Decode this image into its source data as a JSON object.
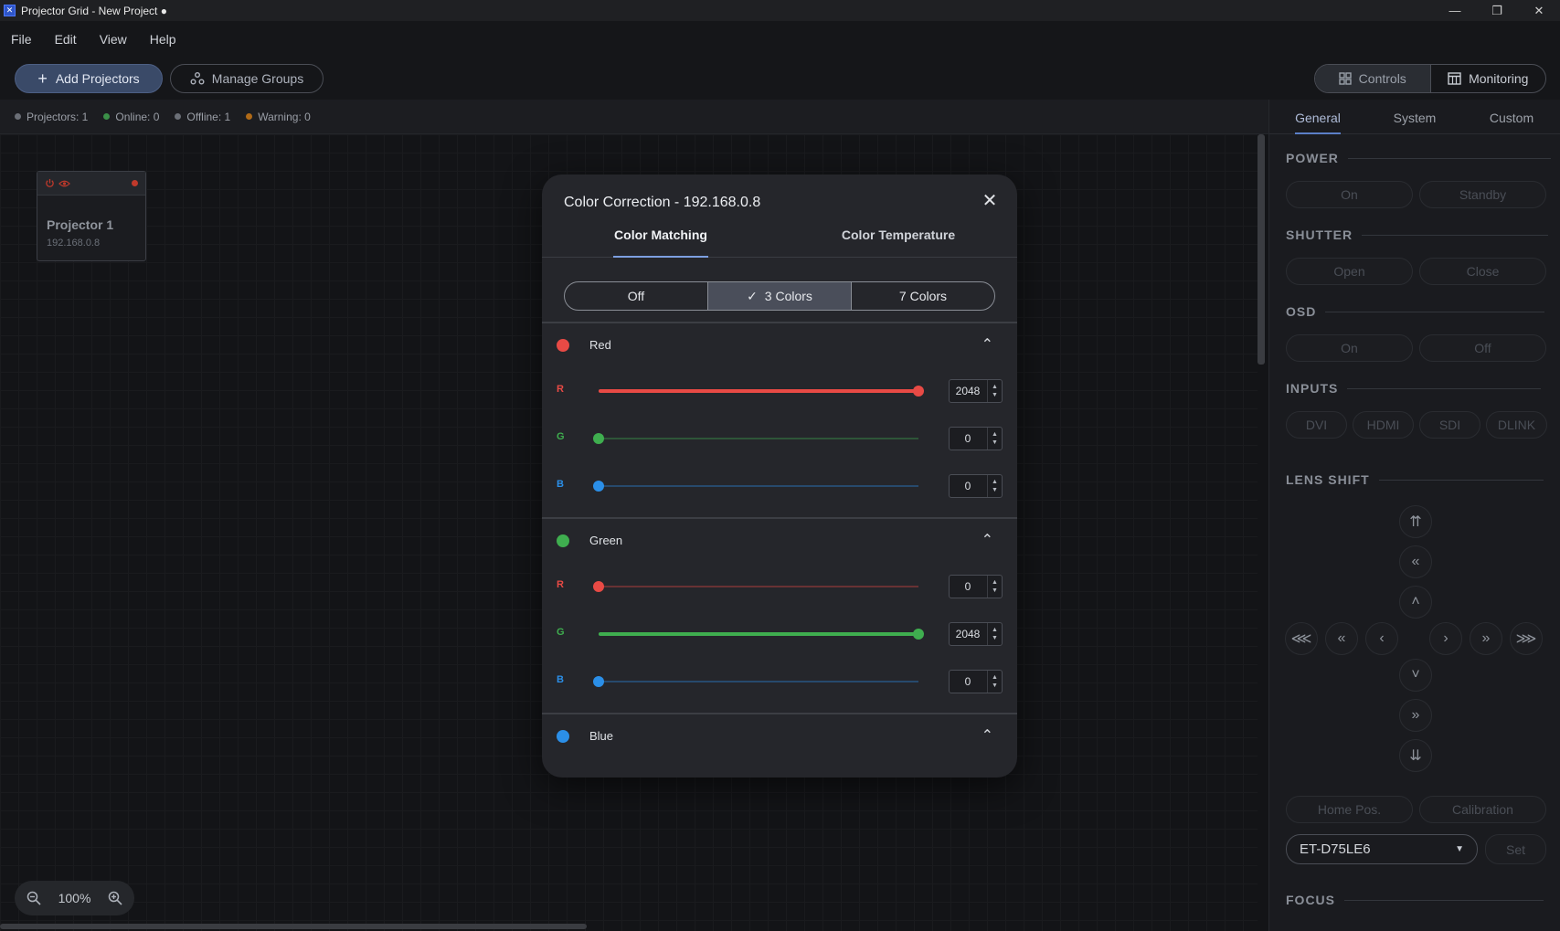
{
  "window": {
    "title": "Projector Grid - New Project ●",
    "icon": "app-icon"
  },
  "menu": [
    "File",
    "Edit",
    "View",
    "Help"
  ],
  "toolbar": {
    "add_projectors": "Add Projectors",
    "manage_groups": "Manage Groups",
    "controls": "Controls",
    "monitoring": "Monitoring"
  },
  "status": {
    "projectors": "Projectors: 1",
    "online": "Online: 0",
    "offline": "Offline: 1",
    "warning": "Warning: 0",
    "colors": {
      "projectors": "#6b6f77",
      "online": "#3b8f48",
      "offline": "#6b6f77",
      "warning": "#b06a17"
    }
  },
  "canvas": {
    "projector": {
      "name": "Projector 1",
      "ip": "192.168.0.8"
    },
    "zoom": "100%"
  },
  "panel": {
    "tabs": [
      "General",
      "System",
      "Custom"
    ],
    "active_tab": "General",
    "power": {
      "title": "POWER",
      "on": "On",
      "standby": "Standby"
    },
    "shutter": {
      "title": "SHUTTER",
      "open": "Open",
      "close": "Close"
    },
    "osd": {
      "title": "OSD",
      "on": "On",
      "off": "Off"
    },
    "inputs": {
      "title": "INPUTS",
      "items": [
        "DVI",
        "HDMI",
        "SDI",
        "DLINK"
      ]
    },
    "lens_shift": {
      "title": "LENS SHIFT"
    },
    "home_pos": "Home Pos.",
    "calibration": "Calibration",
    "lens_model": "ET-D75LE6",
    "set": "Set",
    "focus": {
      "title": "FOCUS"
    }
  },
  "dialog": {
    "title": "Color Correction - 192.168.0.8",
    "tabs": [
      "Color Matching",
      "Color Temperature"
    ],
    "active_tab": "Color Matching",
    "modes": [
      "Off",
      "3 Colors",
      "7 Colors"
    ],
    "active_mode": "3 Colors",
    "slider_max": 2048,
    "groups": [
      {
        "name": "Red",
        "color": "#e84a45",
        "channels": [
          {
            "label": "R",
            "value": 2048
          },
          {
            "label": "G",
            "value": 0
          },
          {
            "label": "B",
            "value": 0
          }
        ]
      },
      {
        "name": "Green",
        "color": "#3fae4f",
        "channels": [
          {
            "label": "R",
            "value": 0
          },
          {
            "label": "G",
            "value": 2048
          },
          {
            "label": "B",
            "value": 0
          }
        ]
      },
      {
        "name": "Blue",
        "color": "#2b8fe8"
      }
    ],
    "channel_colors": {
      "R": "#e84a45",
      "G": "#3fae4f",
      "B": "#2b8fe8"
    }
  }
}
